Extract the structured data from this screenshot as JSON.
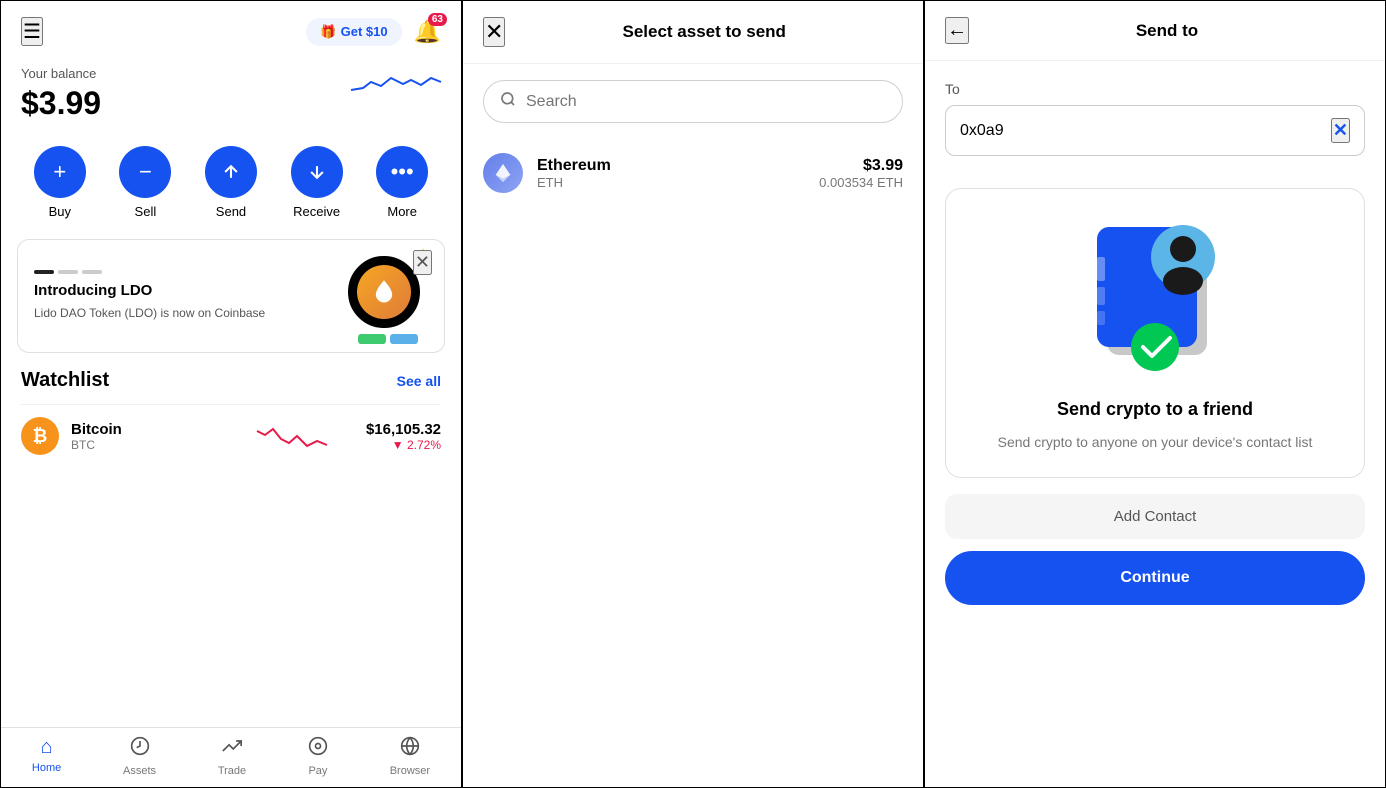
{
  "left": {
    "header": {
      "get_btn": "Get $10",
      "notif_count": "63"
    },
    "balance": {
      "label": "Your balance",
      "amount": "$3.99"
    },
    "actions": [
      {
        "id": "buy",
        "label": "Buy",
        "icon": "+"
      },
      {
        "id": "sell",
        "label": "Sell",
        "icon": "−"
      },
      {
        "id": "send",
        "label": "Send",
        "icon": "↑"
      },
      {
        "id": "receive",
        "label": "Receive",
        "icon": "↓"
      },
      {
        "id": "more",
        "label": "More",
        "icon": "···"
      }
    ],
    "promo": {
      "title": "Introducing LDO",
      "desc": "Lido DAO Token (LDO) is now on Coinbase"
    },
    "watchlist": {
      "title": "Watchlist",
      "see_all": "See all"
    },
    "bitcoin": {
      "name": "Bitcoin",
      "symbol": "BTC",
      "price": "$16,105.32",
      "change": "▼ 2.72%"
    },
    "nav": [
      {
        "id": "home",
        "label": "Home",
        "active": true
      },
      {
        "id": "assets",
        "label": "Assets",
        "active": false
      },
      {
        "id": "trade",
        "label": "Trade",
        "active": false
      },
      {
        "id": "pay",
        "label": "Pay",
        "active": false
      },
      {
        "id": "browser",
        "label": "Browser",
        "active": false
      }
    ]
  },
  "middle": {
    "title": "Select asset to send",
    "close": "✕",
    "search_placeholder": "Search",
    "asset": {
      "name": "Ethereum",
      "symbol": "ETH",
      "usd": "$3.99",
      "eth": "0.003534 ETH"
    }
  },
  "right": {
    "title": "Send to",
    "back": "←",
    "to_label": "To",
    "address": "0x0a9",
    "card": {
      "title": "Send crypto to a friend",
      "desc": "Send crypto to anyone on your device's contact list"
    },
    "add_contact": "Add Contact",
    "continue": "Continue"
  }
}
